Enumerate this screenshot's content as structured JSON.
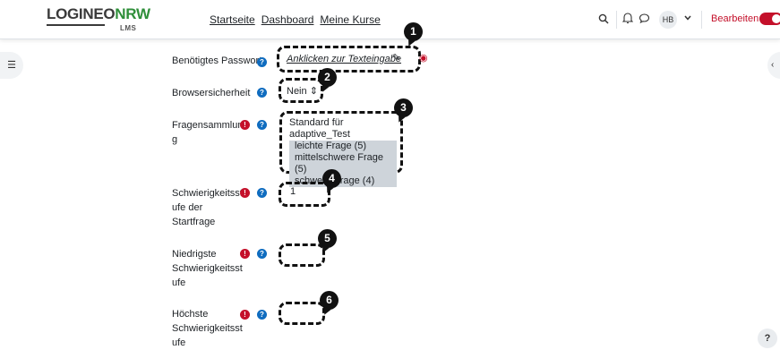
{
  "header": {
    "logo_main_a": "LOGINEO",
    "logo_main_b": "NRW",
    "logo_sub": "LMS",
    "nav": [
      "Startseite",
      "Dashboard",
      "Meine Kurse"
    ],
    "avatar": "HB",
    "edit_label": "Bearbeiten"
  },
  "form": {
    "password_label": "Benötigtes Passwort",
    "password_link": "Anklicken zur Texteingabe",
    "browser_label": "Browsersicherheit",
    "browser_value": "Nein",
    "question_bank_label": [
      "Fragensammlun",
      "g"
    ],
    "question_bank": {
      "group": "Standard für adaptive_Test",
      "options": [
        "leichte Frage (5)",
        "mittelschwere Frage (5)",
        "schwere Frage (4)"
      ]
    },
    "start_level_label": [
      "Schwierigkeitsst",
      "ufe der",
      "Startfrage"
    ],
    "start_level_value": "1",
    "lowest_label": [
      "Niedrigste",
      "Schwierigkeitsst",
      "ufe"
    ],
    "highest_label": [
      "Höchste",
      "Schwierigkeitsst",
      "ufe"
    ]
  },
  "markers": [
    "1",
    "2",
    "3",
    "4",
    "5",
    "6"
  ],
  "help_button": "?"
}
